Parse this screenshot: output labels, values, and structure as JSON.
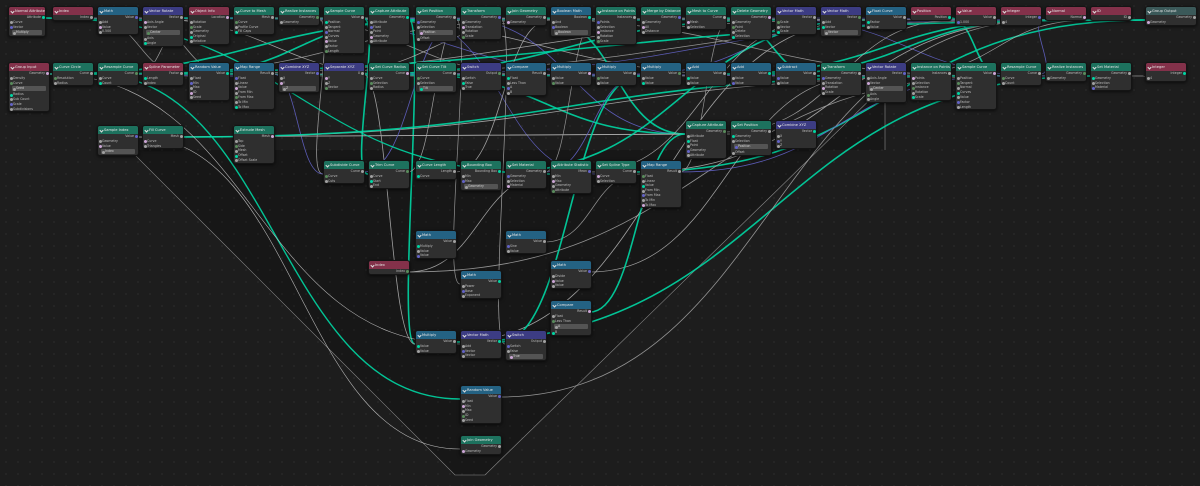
{
  "editor": {
    "title": "Geometry Node Editor"
  },
  "colors": {
    "background": "#1d1d1d",
    "input_header": "#83314a",
    "geometry_header": "#1d725e",
    "converter_header": "#246283",
    "vector_header": "#3c3c83",
    "wire_geometry": "#00d6a3",
    "wire_vector": "#6363c7",
    "wire_float": "#a1a1a1"
  },
  "icons": {
    "collapse": "chevron-down-icon",
    "socket": "circle-socket-icon"
  },
  "nodes": {
    "normal_attr": {
      "title": "Normal Attribute",
      "rows": [
        "Attribute",
        "Curve",
        "Vector",
        "Multiply"
      ]
    },
    "index_a": {
      "title": "Index",
      "rows": [
        "Index"
      ]
    },
    "math_a": {
      "title": "Math",
      "rows": [
        "Value",
        "Add",
        "Value",
        "0.500"
      ]
    },
    "vec_rotate": {
      "title": "Vector Rotate",
      "rows": [
        "Vector",
        "Axis Angle",
        "Vector",
        "Center",
        "Axis",
        "Angle"
      ]
    },
    "object_info": {
      "title": "Object Info",
      "rows": [
        "Location",
        "Rotation",
        "Scale",
        "Geometry",
        "Original",
        "Relative"
      ]
    },
    "curve_to_mesh": {
      "title": "Curve to Mesh",
      "rows": [
        "Mesh",
        "Curve",
        "Profile Curve",
        "Fill Caps"
      ]
    },
    "realize": {
      "title": "Realize Instances",
      "rows": [
        "Geometry",
        "Geometry"
      ]
    },
    "sample_curve": {
      "title": "Sample Curve",
      "rows": [
        "Value",
        "Position",
        "Tangent",
        "Normal",
        "Curves",
        "Value",
        "Factor",
        "Length"
      ]
    },
    "capture": {
      "title": "Capture Attribute",
      "rows": [
        "Geometry",
        "Attribute",
        "Float",
        "Point",
        "Geometry",
        "Attribute"
      ]
    },
    "set_position": {
      "title": "Set Position",
      "rows": [
        "Geometry",
        "Geometry",
        "Selection",
        "Position",
        "Offset"
      ]
    },
    "transform": {
      "title": "Transform",
      "rows": [
        "Geometry",
        "Geometry",
        "Translation",
        "Rotation",
        "Scale"
      ]
    },
    "join": {
      "title": "Join Geometry",
      "rows": [
        "Geometry",
        "Geometry"
      ]
    },
    "group_output": {
      "title": "Group Output",
      "rows": [
        "Geometry",
        "Geometry"
      ]
    },
    "group_input": {
      "title": "Group Input",
      "rows": [
        "Geometry",
        "Density",
        "Curve",
        "Seed",
        "Radius",
        "Sub Count",
        "Scale",
        "Subdivisions"
      ]
    },
    "curve_circle": {
      "title": "Curve Circle",
      "rows": [
        "Curve",
        "Resolution",
        "Radius"
      ]
    },
    "resample": {
      "title": "Resample Curve",
      "rows": [
        "Curve",
        "Curve",
        "Count"
      ]
    },
    "spline_param": {
      "title": "Spline Parameter",
      "rows": [
        "Factor",
        "Length",
        "Index"
      ]
    },
    "random_value": {
      "title": "Random Value",
      "rows": [
        "Value",
        "Float",
        "Min",
        "Max",
        "ID",
        "Seed"
      ]
    },
    "map_range": {
      "title": "Map Range",
      "rows": [
        "Result",
        "Float",
        "Linear",
        "Value",
        "From Min",
        "From Max",
        "To Min",
        "To Max"
      ]
    },
    "combine_xyz": {
      "title": "Combine XYZ",
      "rows": [
        "Vector",
        "X",
        "Y",
        "Z"
      ]
    },
    "separate_xyz": {
      "title": "Separate XYZ",
      "rows": [
        "X",
        "Y",
        "Z",
        "Vector"
      ]
    },
    "set_radius": {
      "title": "Set Curve Radius",
      "rows": [
        "Curve",
        "Curve",
        "Selection",
        "Radius"
      ]
    },
    "set_tilt": {
      "title": "Set Curve Tilt",
      "rows": [
        "Curve",
        "Curve",
        "Selection",
        "Tilt"
      ]
    },
    "switch": {
      "title": "Switch",
      "rows": [
        "Output",
        "Switch",
        "False",
        "True"
      ]
    },
    "compare": {
      "title": "Compare",
      "rows": [
        "Result",
        "Float",
        "Less Than",
        "A",
        "B"
      ]
    },
    "boolean_math": {
      "title": "Boolean Math",
      "rows": [
        "Boolean",
        "And",
        "Boolean",
        "Boolean"
      ]
    },
    "instance_on_points": {
      "title": "Instance on Points",
      "rows": [
        "Instances",
        "Points",
        "Selection",
        "Instance",
        "Rotation",
        "Scale"
      ]
    },
    "merge_by_distance": {
      "title": "Merge by Distance",
      "rows": [
        "Geometry",
        "Geometry",
        "All",
        "Distance"
      ]
    },
    "mesh_to_curve": {
      "title": "Mesh to Curve",
      "rows": [
        "Curve",
        "Mesh",
        "Selection"
      ]
    },
    "delete_geo": {
      "title": "Delete Geometry",
      "rows": [
        "Geometry",
        "Geometry",
        "Point",
        "Delete",
        "Selection"
      ]
    },
    "vec_math_scale": {
      "title": "Vector Math",
      "rows": [
        "Vector",
        "Scale",
        "Vector",
        "Scale"
      ]
    },
    "vec_math_add": {
      "title": "Vector Math",
      "rows": [
        "Vector",
        "Add",
        "Vector",
        "Vector"
      ]
    },
    "float_curve": {
      "title": "Float Curve",
      "rows": [
        "Value",
        "Factor",
        "Value"
      ]
    },
    "position": {
      "title": "Position",
      "rows": [
        "Position"
      ]
    },
    "value": {
      "title": "Value",
      "rows": [
        "Value",
        "1.000"
      ]
    },
    "integer": {
      "title": "Integer",
      "rows": [
        "Integer",
        "4"
      ]
    },
    "multiply_a": {
      "title": "Multiply",
      "rows": [
        "Value",
        "Value",
        "Value"
      ]
    },
    "multiply_b": {
      "title": "Multiply",
      "rows": [
        "Value",
        "Value",
        "Value"
      ]
    },
    "multiply_c": {
      "title": "Multiply",
      "rows": [
        "Value",
        "Value",
        "Value"
      ]
    },
    "add_a": {
      "title": "Add",
      "rows": [
        "Value",
        "Value",
        "Value"
      ]
    },
    "add_b": {
      "title": "Add",
      "rows": [
        "Value",
        "Value",
        "Value"
      ]
    },
    "subtract": {
      "title": "Subtract",
      "rows": [
        "Value",
        "Value",
        "Value"
      ]
    },
    "sample_index": {
      "title": "Sample Index",
      "rows": [
        "Value",
        "Geometry",
        "Value",
        "Index"
      ]
    },
    "fill_curve": {
      "title": "Fill Curve",
      "rows": [
        "Mesh",
        "Curve",
        "Triangles"
      ]
    },
    "extrude": {
      "title": "Extrude Mesh",
      "rows": [
        "Mesh",
        "Top",
        "Side",
        "Mesh",
        "Offset",
        "Offset Scale"
      ]
    },
    "subdivide": {
      "title": "Subdivide Curve",
      "rows": [
        "Curve",
        "Curve",
        "Cuts"
      ]
    },
    "trim_curve": {
      "title": "Trim Curve",
      "rows": [
        "Curve",
        "Curve",
        "Start",
        "End"
      ]
    },
    "curve_length": {
      "title": "Curve Length",
      "rows": [
        "Length",
        "Curve"
      ]
    },
    "bounding_box": {
      "title": "Bounding Box",
      "rows": [
        "Bounding Box",
        "Min",
        "Max",
        "Geometry"
      ]
    },
    "set_material": {
      "title": "Set Material",
      "rows": [
        "Geometry",
        "Geometry",
        "Selection",
        "Material"
      ]
    },
    "attr_stat": {
      "title": "Attribute Statistic",
      "rows": [
        "Mean",
        "Min",
        "Max",
        "Geometry",
        "Attribute"
      ]
    },
    "string_to_curves": {
      "title": "Set Spline Type",
      "rows": [
        "Curve",
        "Curve",
        "Selection"
      ]
    },
    "normal": {
      "title": "Normal",
      "rows": [
        "Normal"
      ]
    },
    "id": {
      "title": "ID",
      "rows": [
        "ID"
      ]
    },
    "index_b": {
      "title": "Index",
      "rows": [
        "Index"
      ]
    },
    "math_b": {
      "title": "Math",
      "rows": [
        "Value",
        "Multiply",
        "Value",
        "Value"
      ]
    },
    "math_c": {
      "title": "Math",
      "rows": [
        "Value",
        "Power",
        "Base",
        "Exponent"
      ]
    },
    "math_d": {
      "title": "Math",
      "rows": [
        "Value",
        "Sine",
        "Value"
      ]
    },
    "math_e": {
      "title": "Math",
      "rows": [
        "Value",
        "Divide",
        "Value",
        "Value"
      ]
    }
  }
}
